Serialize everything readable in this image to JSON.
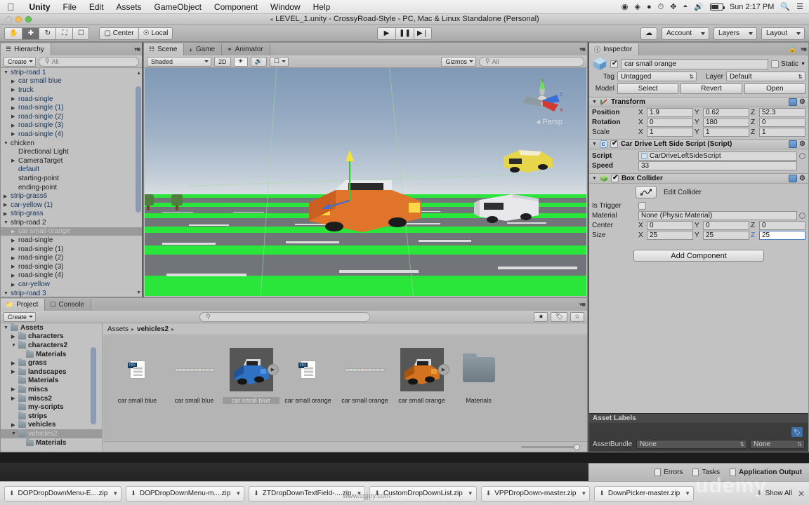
{
  "macbar": {
    "apple": "apple-logo",
    "menus": [
      "Unity",
      "File",
      "Edit",
      "Assets",
      "GameObject",
      "Component",
      "Window",
      "Help"
    ],
    "clock": "Sun 2:17 PM",
    "status_icons": [
      "record-icon",
      "creative-cloud-icon",
      "dropbox-icon",
      "time-machine-icon",
      "bluetooth-icon",
      "wifi-icon",
      "volume-icon",
      "battery-icon"
    ]
  },
  "titlebar": {
    "title": "LEVEL_1.unity - CrossyRoad-Style - PC, Mac & Linux Standalone (Personal)",
    "lock_icon": "lock-icon"
  },
  "toolbar": {
    "transform_tools": [
      "hand-tool",
      "move-tool",
      "rotate-tool",
      "scale-tool",
      "rect-tool"
    ],
    "active_tool_index": 1,
    "pivot_mode": "Center",
    "pivot_rotation": "Local",
    "play": "play-button",
    "pause": "pause-button",
    "step": "step-button",
    "cloud": "cloud-icon",
    "account": "Account",
    "layers": "Layers",
    "layout": "Layout"
  },
  "hierarchy": {
    "tab": "Hierarchy",
    "create_label": "Create",
    "search_placeholder": "All",
    "items": [
      {
        "label": "strip-road 1",
        "indent": 0,
        "arrow": "open",
        "style": "link"
      },
      {
        "label": "car small blue",
        "indent": 1,
        "arrow": "closed",
        "style": "link"
      },
      {
        "label": "truck",
        "indent": 1,
        "arrow": "closed",
        "style": "link"
      },
      {
        "label": "road-single",
        "indent": 1,
        "arrow": "closed",
        "style": "link"
      },
      {
        "label": "road-single (1)",
        "indent": 1,
        "arrow": "closed",
        "style": "link"
      },
      {
        "label": "road-single (2)",
        "indent": 1,
        "arrow": "closed",
        "style": "link"
      },
      {
        "label": "road-single (3)",
        "indent": 1,
        "arrow": "closed",
        "style": "link"
      },
      {
        "label": "road-single (4)",
        "indent": 1,
        "arrow": "closed",
        "style": "link"
      },
      {
        "label": "chicken",
        "indent": 0,
        "arrow": "open",
        "style": "dark"
      },
      {
        "label": "Directional Light",
        "indent": 1,
        "arrow": "none",
        "style": "dark"
      },
      {
        "label": "CameraTarget",
        "indent": 1,
        "arrow": "closed",
        "style": "dark"
      },
      {
        "label": "default",
        "indent": 1,
        "arrow": "none",
        "style": "link"
      },
      {
        "label": "starting-point",
        "indent": 1,
        "arrow": "none",
        "style": "dark"
      },
      {
        "label": "ending-point",
        "indent": 1,
        "arrow": "none",
        "style": "dark"
      },
      {
        "label": "strip-grass6",
        "indent": 0,
        "arrow": "closed",
        "style": "link"
      },
      {
        "label": "car-yellow (1)",
        "indent": 0,
        "arrow": "closed",
        "style": "link"
      },
      {
        "label": "strip-grass",
        "indent": 0,
        "arrow": "closed",
        "style": "link"
      },
      {
        "label": "strip-road 2",
        "indent": 0,
        "arrow": "open",
        "style": "dark"
      },
      {
        "label": "car small orange",
        "indent": 1,
        "arrow": "closed",
        "style": "selected"
      },
      {
        "label": "road-single",
        "indent": 1,
        "arrow": "closed",
        "style": "dark"
      },
      {
        "label": "road-single (1)",
        "indent": 1,
        "arrow": "closed",
        "style": "dark"
      },
      {
        "label": "road-single (2)",
        "indent": 1,
        "arrow": "closed",
        "style": "dark"
      },
      {
        "label": "road-single (3)",
        "indent": 1,
        "arrow": "closed",
        "style": "dark"
      },
      {
        "label": "road-single (4)",
        "indent": 1,
        "arrow": "closed",
        "style": "dark"
      },
      {
        "label": "car-yellow",
        "indent": 1,
        "arrow": "closed",
        "style": "link"
      },
      {
        "label": "strip-road 3",
        "indent": 0,
        "arrow": "open",
        "style": "link"
      }
    ]
  },
  "scene": {
    "tabs": [
      {
        "label": "Scene",
        "icon": "scene-icon",
        "active": true
      },
      {
        "label": "Game",
        "icon": "game-icon",
        "active": false
      },
      {
        "label": "Animator",
        "icon": "animator-icon",
        "active": false
      }
    ],
    "shading_mode": "Shaded",
    "mode_2d": "2D",
    "lighting_icon": "lighting-icon",
    "audio_icon": "audio-icon",
    "fx_icon": "effects-icon",
    "gizmos_label": "Gizmos",
    "search_placeholder": "All",
    "persp_label": "Persp",
    "gizmo_axes": [
      "Y",
      "X",
      "Z"
    ]
  },
  "inspector": {
    "tab": "Inspector",
    "lock_icon": "lock-icon",
    "object_name": "car small orange",
    "enabled": true,
    "static_label": "Static",
    "static_checked": false,
    "tag_label": "Tag",
    "tag_value": "Untagged",
    "layer_label": "Layer",
    "layer_value": "Default",
    "model_label": "Model",
    "model_buttons": [
      "Select",
      "Revert",
      "Open"
    ],
    "transform": {
      "title": "Transform",
      "rows": [
        {
          "name": "Position",
          "x": "1.9",
          "y": "0.62",
          "z": "52.3"
        },
        {
          "name": "Rotation",
          "x": "0",
          "y": "180",
          "z": "0"
        },
        {
          "name": "Scale",
          "x": "1",
          "y": "1",
          "z": "1"
        }
      ]
    },
    "script_component": {
      "title": "Car Drive Left Side Script (Script)",
      "enabled": true,
      "script_label": "Script",
      "script_value": "CarDriveLeftSideScript",
      "speed_label": "Speed",
      "speed_value": "33"
    },
    "box_collider": {
      "title": "Box Collider",
      "enabled": true,
      "edit_collider_label": "Edit Collider",
      "is_trigger_label": "Is Trigger",
      "is_trigger_checked": false,
      "material_label": "Material",
      "material_value": "None (Physic Material)",
      "center": {
        "name": "Center",
        "x": "0",
        "y": "0",
        "z": "0"
      },
      "size": {
        "name": "Size",
        "x": "25",
        "y": "25",
        "z": "25"
      }
    },
    "add_component_label": "Add Component",
    "asset_labels": {
      "title": "Asset Labels",
      "tag_icon": "label-tag-icon",
      "bundle_label": "AssetBundle",
      "bundle_value": "None",
      "variant_value": "None"
    }
  },
  "project": {
    "tabs": [
      {
        "label": "Project",
        "icon": "project-icon",
        "active": true
      },
      {
        "label": "Console",
        "icon": "console-icon",
        "active": false
      }
    ],
    "create_label": "Create",
    "search_placeholder": "",
    "tree": [
      {
        "label": "Assets",
        "indent": 0,
        "arrow": "open",
        "style": "dark"
      },
      {
        "label": "characters",
        "indent": 1,
        "arrow": "closed",
        "style": "dark"
      },
      {
        "label": "characters2",
        "indent": 1,
        "arrow": "open",
        "style": "dark"
      },
      {
        "label": "Materials",
        "indent": 2,
        "arrow": "none",
        "style": "dark"
      },
      {
        "label": "grass",
        "indent": 1,
        "arrow": "closed",
        "style": "dark"
      },
      {
        "label": "landscapes",
        "indent": 1,
        "arrow": "closed",
        "style": "dark"
      },
      {
        "label": "Materials",
        "indent": 1,
        "arrow": "none",
        "style": "dark"
      },
      {
        "label": "miscs",
        "indent": 1,
        "arrow": "closed",
        "style": "dark"
      },
      {
        "label": "miscs2",
        "indent": 1,
        "arrow": "closed",
        "style": "dark"
      },
      {
        "label": "my-scripts",
        "indent": 1,
        "arrow": "none",
        "style": "dark"
      },
      {
        "label": "strips",
        "indent": 1,
        "arrow": "none",
        "style": "dark"
      },
      {
        "label": "vehicles",
        "indent": 1,
        "arrow": "closed",
        "style": "dark"
      },
      {
        "label": "vehicles2",
        "indent": 1,
        "arrow": "open",
        "style": "selected"
      },
      {
        "label": "Materials",
        "indent": 2,
        "arrow": "none",
        "style": "dark"
      }
    ],
    "breadcrumb": [
      "Assets",
      "vehicles2"
    ],
    "assets": [
      {
        "label": "car small blue",
        "kind": "fbx",
        "selected": false
      },
      {
        "label": "car small blue",
        "kind": "anim",
        "selected": false
      },
      {
        "label": "car small blue",
        "kind": "prefab-blue",
        "selected": true
      },
      {
        "label": "car small orange",
        "kind": "fbx",
        "selected": false
      },
      {
        "label": "car small orange",
        "kind": "anim",
        "selected": false
      },
      {
        "label": "car small orange",
        "kind": "prefab-orange",
        "selected": false
      },
      {
        "label": "Materials",
        "kind": "folder",
        "selected": false
      }
    ]
  },
  "status": {
    "items": [
      {
        "label": "Errors",
        "icon": "errors-icon",
        "bold": false
      },
      {
        "label": "Tasks",
        "icon": "tasks-icon",
        "bold": false
      },
      {
        "label": "Application Output",
        "icon": "output-icon",
        "bold": true
      }
    ]
  },
  "downloads": {
    "items": [
      "DOPDropDownMenu-E....zip",
      "DOPDropDownMenu-m....zip",
      "ZTDropDownTextField-....zip",
      "CustomDropDownList.zip",
      "VPPDropDown-master.zip",
      "DownPicker-master.zip"
    ],
    "show_all": "Show All",
    "close": "close-icon"
  },
  "watermarks": {
    "brand": "udemy",
    "site": "www.cgjoy.com"
  }
}
